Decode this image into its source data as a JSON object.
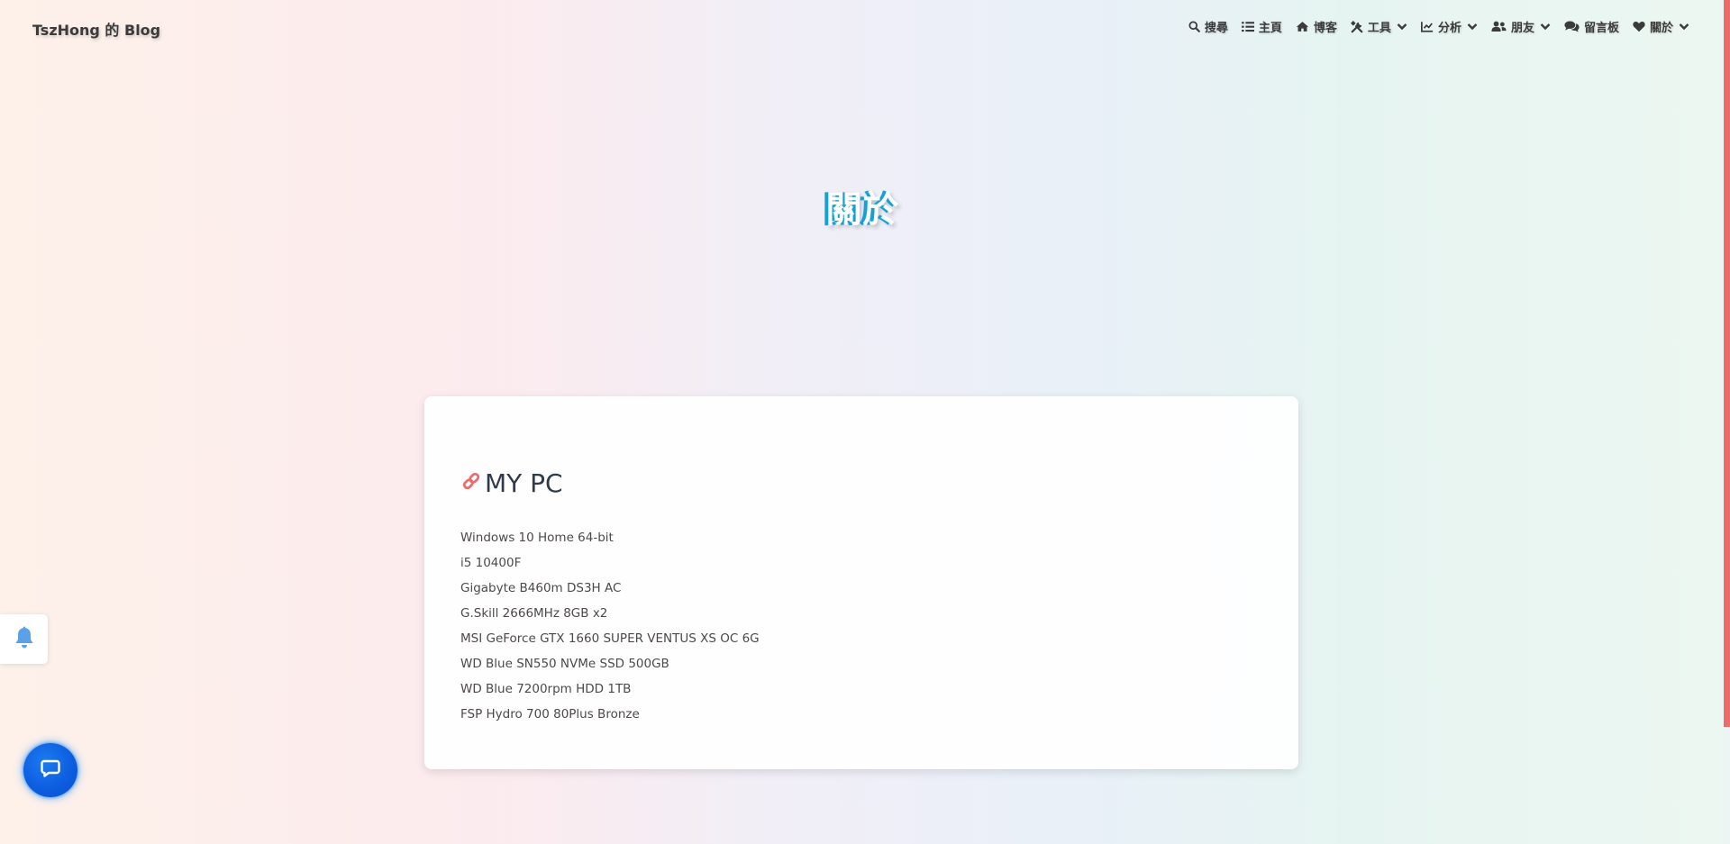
{
  "site": {
    "brand": "TszHong 的 Blog"
  },
  "nav": {
    "items": [
      {
        "label": "搜尋",
        "icon": "search-icon",
        "dropdown": false
      },
      {
        "label": "主頁",
        "icon": "list-icon",
        "dropdown": false
      },
      {
        "label": "博客",
        "icon": "home-icon",
        "dropdown": false
      },
      {
        "label": "工具",
        "icon": "tools-icon",
        "dropdown": true
      },
      {
        "label": "分析",
        "icon": "chart-line-icon",
        "dropdown": true
      },
      {
        "label": "朋友",
        "icon": "users-icon",
        "dropdown": true
      },
      {
        "label": "留言板",
        "icon": "comments-icon",
        "dropdown": false
      },
      {
        "label": "關於",
        "icon": "heart-icon",
        "dropdown": true
      }
    ]
  },
  "hero": {
    "title": "關於"
  },
  "card": {
    "heading": "MY PC",
    "heading_icon": "link-icon",
    "specs": [
      "Windows 10 Home 64-bit",
      "i5 10400F",
      "Gigabyte B460m DS3H AC",
      "G.Skill 2666MHz 8GB x2",
      "MSI GeForce GTX 1660 SUPER VENTUS XS OC 6G",
      "WD Blue SN550 NVMe SSD 500GB",
      "WD Blue 7200rpm HDD 1TB",
      "FSP Hydro 700 80Plus Bronze"
    ]
  },
  "floating": {
    "bell_icon": "bell-icon",
    "chat_icon": "chat-bubble-icon"
  },
  "colors": {
    "accent_blue": "#12a3d6",
    "link_icon": "#ec6c6c",
    "progress_bar": "#ec6c6c",
    "chat_button": "#0d5ee0"
  }
}
